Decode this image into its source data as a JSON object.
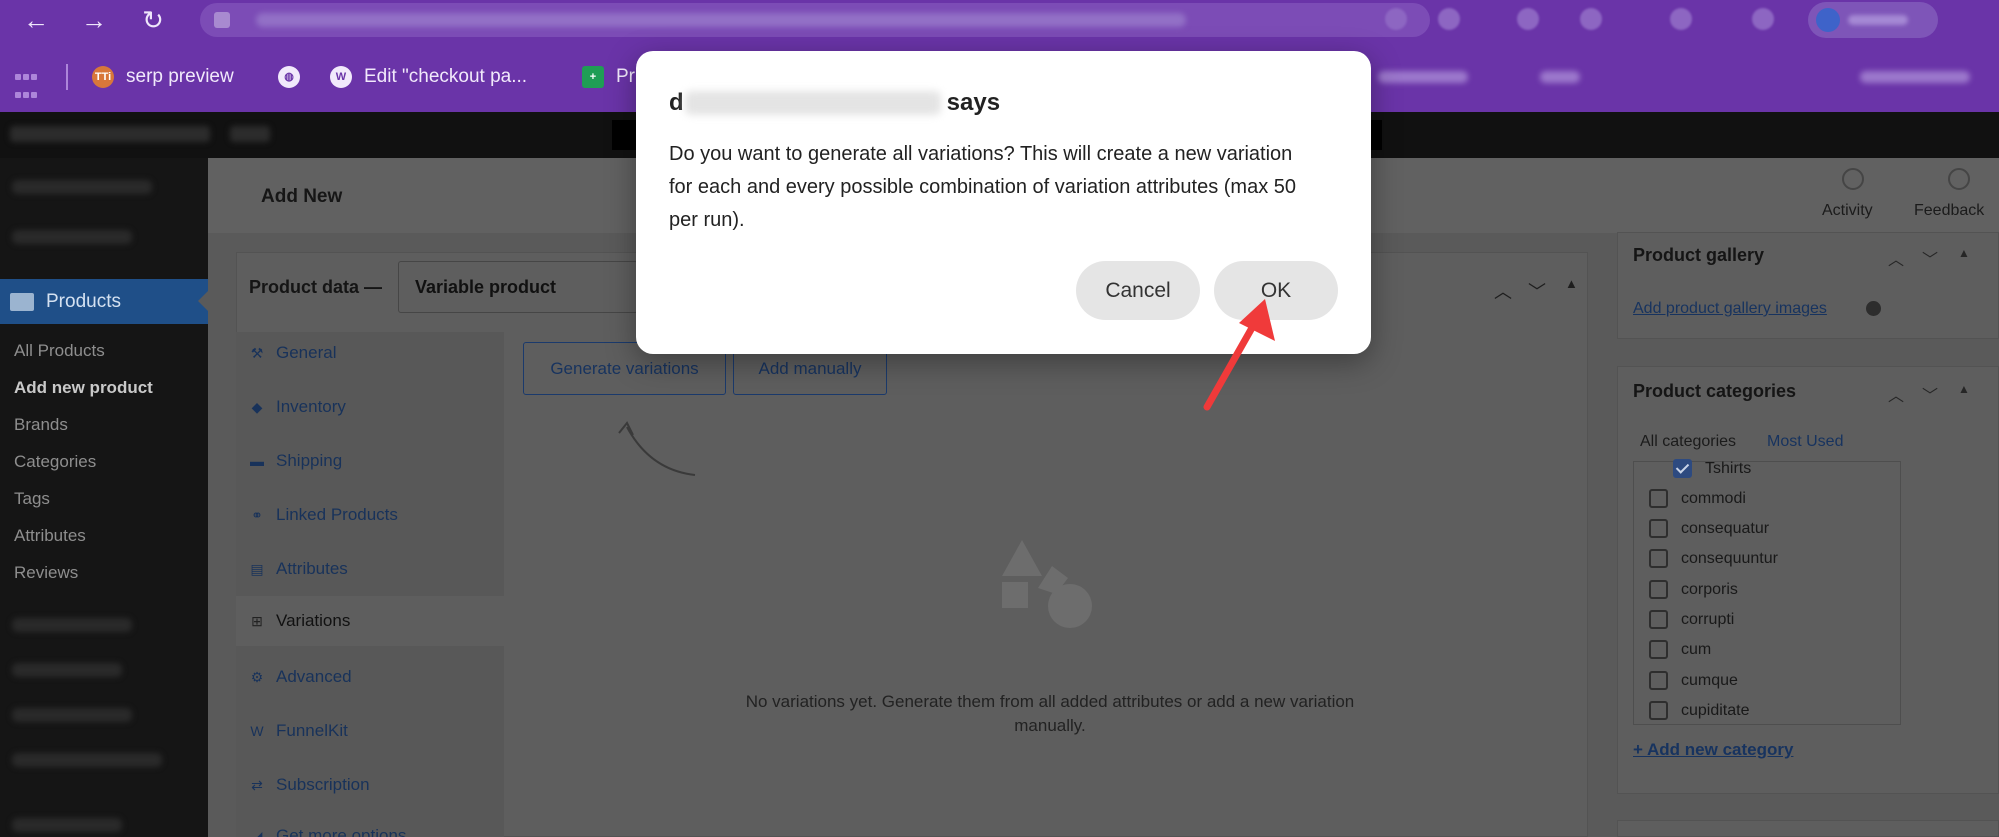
{
  "browser": {
    "back_icon": "←",
    "forward_icon": "→",
    "reload_icon": "↻",
    "bookmarks": [
      {
        "label": "serp preview",
        "icon": "TTi",
        "icon_color": "#d8773a"
      },
      {
        "label": "",
        "icon": "globe-icon"
      },
      {
        "label": "Edit \"checkout pa...",
        "icon": "wordpress-icon"
      },
      {
        "label": "Pr",
        "icon": "plus-icon",
        "icon_color": "#1f9d55"
      }
    ]
  },
  "header": {
    "page_title": "Add New",
    "activity": "Activity",
    "feedback": "Feedback"
  },
  "sidebar": {
    "products": "Products",
    "submenu": [
      "All Products",
      "Add new product",
      "Brands",
      "Categories",
      "Tags",
      "Attributes",
      "Reviews"
    ]
  },
  "product_data": {
    "label": "Product data —",
    "type": "Variable product",
    "tabs": [
      {
        "label": "General",
        "icon": "⚒"
      },
      {
        "label": "Inventory",
        "icon": "◆"
      },
      {
        "label": "Shipping",
        "icon": "▬"
      },
      {
        "label": "Linked Products",
        "icon": "⚭"
      },
      {
        "label": "Attributes",
        "icon": "▤"
      },
      {
        "label": "Variations",
        "icon": "⊞"
      },
      {
        "label": "Advanced",
        "icon": "⚙"
      },
      {
        "label": "FunnelKit",
        "icon": "W"
      },
      {
        "label": "Subscription",
        "icon": "⇄"
      },
      {
        "label": "Get more options",
        "icon": "◢"
      }
    ],
    "generate_btn": "Generate variations",
    "add_manually_btn": "Add manually",
    "empty_msg": "No variations yet. Generate them from all added attributes or add a new variation manually."
  },
  "gallery": {
    "title": "Product gallery",
    "link": "Add product gallery images"
  },
  "categories": {
    "title": "Product categories",
    "tab_all": "All categories",
    "tab_used": "Most Used",
    "items": [
      {
        "label": "Tshirts",
        "checked": true
      },
      {
        "label": "commodi",
        "checked": false
      },
      {
        "label": "consequatur",
        "checked": false
      },
      {
        "label": "consequuntur",
        "checked": false
      },
      {
        "label": "corporis",
        "checked": false
      },
      {
        "label": "corrupti",
        "checked": false
      },
      {
        "label": "cum",
        "checked": false
      },
      {
        "label": "cumque",
        "checked": false
      },
      {
        "label": "cupiditate",
        "checked": false
      }
    ],
    "add_new": "+ Add new category"
  },
  "dialog": {
    "title_prefix": "d",
    "title_suffix": "says",
    "message": "Do you want to generate all variations? This will create a new variation for each and every possible combination of variation attributes (max 50 per run).",
    "cancel": "Cancel",
    "ok": "OK"
  },
  "colors": {
    "browser_chrome": "#6a34a8",
    "annotation_arrow": "#f03a3a"
  }
}
